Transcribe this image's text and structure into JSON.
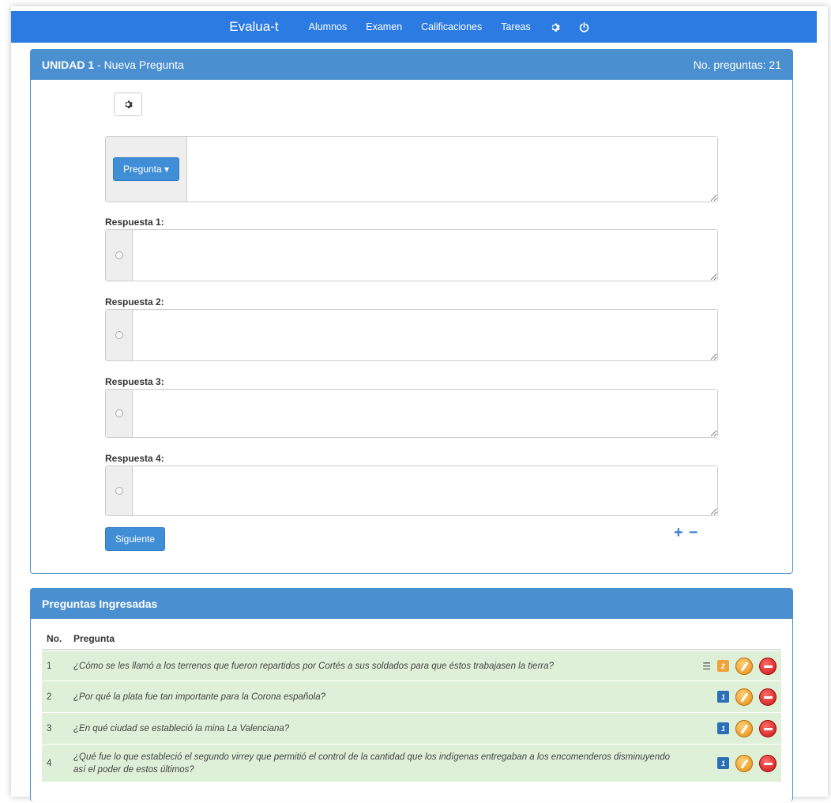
{
  "navbar": {
    "brand": "Evalua-t",
    "links": [
      "Alumnos",
      "Examen",
      "Calificaciones",
      "Tareas"
    ],
    "icons": [
      "gear-icon",
      "power-icon"
    ]
  },
  "new_question_panel": {
    "title_bold": "UNIDAD 1",
    "title_rest": " - Nueva Pregunta",
    "count_label": "No. preguntas: 21",
    "question_button": "Pregunta",
    "answers": [
      {
        "label": "Respuesta 1:"
      },
      {
        "label": "Respuesta 2:"
      },
      {
        "label": "Respuesta 3:"
      },
      {
        "label": "Respuesta 4:"
      }
    ],
    "next_button": "Siguiente",
    "plus": "+",
    "minus": "−"
  },
  "questions_panel": {
    "title": "Preguntas Ingresadas",
    "col_no": "No.",
    "col_question": "Pregunta",
    "rows": [
      {
        "no": "1",
        "text": "¿Cómo se les llamó a los terrenos que fueron repartidos por Cortés a sus soldados para que éstos trabajasen la tierra?",
        "badge": "2",
        "badge_color": "#f0a23a"
      },
      {
        "no": "2",
        "text": "¿Por qué la plata fue tan importante para la Corona española?",
        "badge": "1",
        "badge_color": "#2b6fb8"
      },
      {
        "no": "3",
        "text": "¿En qué ciudad se estableció la mina La Valenciana?",
        "badge": "1",
        "badge_color": "#2b6fb8"
      },
      {
        "no": "4",
        "text": "¿Qué fue lo que estableció el segundo virrey que permitió el control de la cantidad que los indígenas entregaban a los encomenderos disminuyendo así el poder de estos últimos?",
        "badge": "1",
        "badge_color": "#2b6fb8"
      }
    ]
  },
  "colors": {
    "navbar": "#2b7be3",
    "panel_heading": "#4a8fd0",
    "row_bg": "#dff0d8"
  }
}
